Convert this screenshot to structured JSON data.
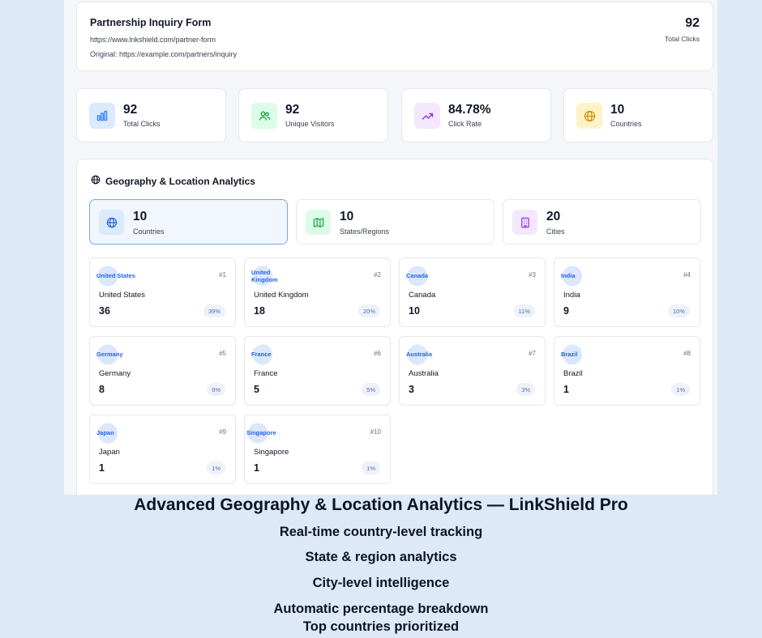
{
  "header": {
    "title": "Partnership Inquiry Form",
    "short_url": "https://www.lnkshield.com/partner-form",
    "original": "Original: https://example.com/partners/inquiry",
    "total_clicks_value": "92",
    "total_clicks_label": "Total Clicks"
  },
  "stats": [
    {
      "value": "92",
      "label": "Total Clicks",
      "icon": "bar-chart-icon",
      "color": "#3b82f6",
      "bg": "#dbeafe"
    },
    {
      "value": "92",
      "label": "Unique Visitors",
      "icon": "users-icon",
      "color": "#16a34a",
      "bg": "#dcfce7"
    },
    {
      "value": "84.78%",
      "label": "Click Rate",
      "icon": "trend-up-icon",
      "color": "#9333ea",
      "bg": "#f3e8ff"
    },
    {
      "value": "10",
      "label": "Countries",
      "icon": "globe-icon",
      "color": "#ca8a04",
      "bg": "#fef3c7"
    }
  ],
  "geo": {
    "title": "Geography & Location Analytics",
    "summary": [
      {
        "value": "10",
        "label": "Countries",
        "icon": "globe-icon",
        "color": "#2563eb",
        "bg": "#dbeafe"
      },
      {
        "value": "10",
        "label": "States/Regions",
        "icon": "map-icon",
        "color": "#16a34a",
        "bg": "#dcfce7"
      },
      {
        "value": "20",
        "label": "Cities",
        "icon": "building-icon",
        "color": "#9333ea",
        "bg": "#f3e8ff"
      }
    ],
    "countries": [
      {
        "flag": "United States",
        "rank": "#1",
        "name": "United States",
        "count": "36",
        "pct": "39%"
      },
      {
        "flag": "United Kingdom",
        "rank": "#2",
        "name": "United Kingdom",
        "count": "18",
        "pct": "20%"
      },
      {
        "flag": "Canada",
        "rank": "#3",
        "name": "Canada",
        "count": "10",
        "pct": "11%"
      },
      {
        "flag": "India",
        "rank": "#4",
        "name": "India",
        "count": "9",
        "pct": "10%"
      },
      {
        "flag": "Germany",
        "rank": "#5",
        "name": "Germany",
        "count": "8",
        "pct": "9%"
      },
      {
        "flag": "France",
        "rank": "#6",
        "name": "France",
        "count": "5",
        "pct": "5%"
      },
      {
        "flag": "Australia",
        "rank": "#7",
        "name": "Australia",
        "count": "3",
        "pct": "3%"
      },
      {
        "flag": "Brazil",
        "rank": "#8",
        "name": "Brazil",
        "count": "1",
        "pct": "1%"
      },
      {
        "flag": "Japan",
        "rank": "#9",
        "name": "Japan",
        "count": "1",
        "pct": "1%"
      },
      {
        "flag": "Singapore",
        "rank": "#10",
        "name": "Singapore",
        "count": "1",
        "pct": "1%"
      }
    ]
  },
  "caption": {
    "title": "Advanced Geography & Location Analytics — LinkShield Pro",
    "lines": [
      "Real-time country-level tracking",
      "State & region analytics",
      "City-level intelligence",
      "Automatic percentage breakdown",
      "Top countries prioritized"
    ]
  }
}
